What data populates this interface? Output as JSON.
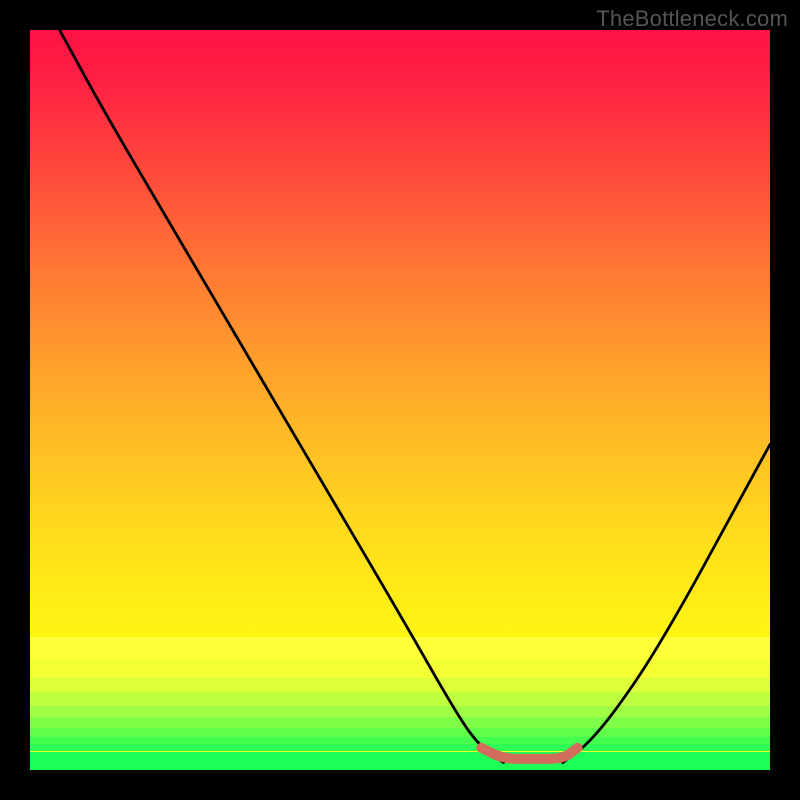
{
  "watermark_text": "TheBottleneck.com",
  "colors": {
    "frame": "#000000",
    "curve_stroke": "#000000",
    "valley_marker": "#d26c5d",
    "green_bottom": "#1cff57"
  },
  "chart_data": {
    "type": "line",
    "title": "",
    "xlabel": "",
    "ylabel": "",
    "xlim": [
      0,
      100
    ],
    "ylim": [
      0,
      100
    ],
    "series": [
      {
        "name": "left-branch",
        "x": [
          4,
          10,
          20,
          30,
          40,
          50,
          58,
          61,
          64
        ],
        "y": [
          100,
          89,
          72,
          55,
          38,
          21,
          7,
          3,
          1
        ]
      },
      {
        "name": "valley-floor",
        "x": [
          61,
          64,
          68,
          72,
          74
        ],
        "y": [
          3,
          1.5,
          1.5,
          1.5,
          3
        ]
      },
      {
        "name": "right-branch",
        "x": [
          72,
          76,
          82,
          88,
          94,
          100
        ],
        "y": [
          1,
          4,
          12,
          22,
          33,
          44
        ]
      }
    ],
    "valley_x_range": [
      61,
      74
    ],
    "grid": false,
    "legend": false
  },
  "gradient_bands": [
    {
      "top_pct": 82.0,
      "h_pct": 3.0,
      "color": "#ffff3a"
    },
    {
      "top_pct": 85.0,
      "h_pct": 2.5,
      "color": "#f3ff34"
    },
    {
      "top_pct": 87.5,
      "h_pct": 2.0,
      "color": "#dcff3a"
    },
    {
      "top_pct": 89.5,
      "h_pct": 1.8,
      "color": "#bfff40"
    },
    {
      "top_pct": 91.3,
      "h_pct": 1.6,
      "color": "#a0ff44"
    },
    {
      "top_pct": 92.9,
      "h_pct": 1.4,
      "color": "#80ff48"
    },
    {
      "top_pct": 94.3,
      "h_pct": 1.2,
      "color": "#60ff4c"
    },
    {
      "top_pct": 95.5,
      "h_pct": 1.0,
      "color": "#45ff50"
    },
    {
      "top_pct": 96.5,
      "h_pct": 1.0,
      "color": "#2eff54"
    },
    {
      "top_pct": 97.5,
      "h_pct": 2.5,
      "color": "#1cff57"
    }
  ]
}
